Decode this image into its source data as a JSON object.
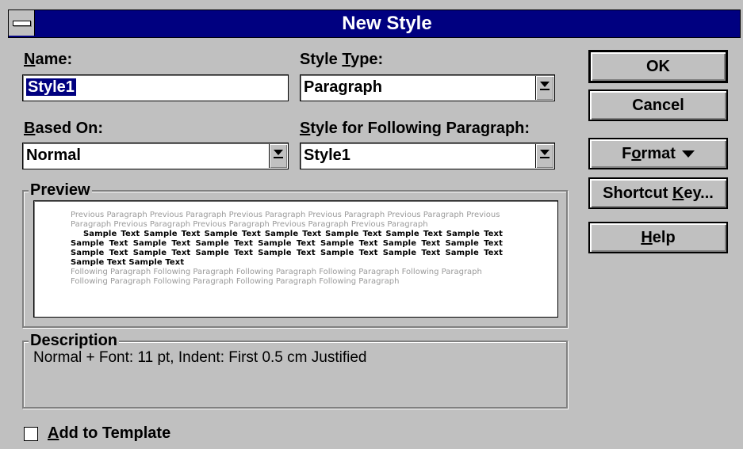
{
  "window": {
    "title": "New Style"
  },
  "fields": {
    "name_label_key": "N",
    "name_label_rest": "ame:",
    "name_value": "Style1",
    "style_type_label_pre": "Style ",
    "style_type_label_key": "T",
    "style_type_label_rest": "ype:",
    "style_type_value": "Paragraph",
    "based_on_label_key": "B",
    "based_on_label_rest": "ased On:",
    "based_on_value": "Normal",
    "following_label_key": "S",
    "following_label_rest": "tyle for Following Paragraph:",
    "following_value": "Style1"
  },
  "buttons": {
    "ok": "OK",
    "cancel": "Cancel",
    "format_pre": "F",
    "format_key": "o",
    "format_rest": "rmat",
    "shortcut_pre": "Shortcut ",
    "shortcut_key": "K",
    "shortcut_rest": "ey...",
    "help_key": "H",
    "help_rest": "elp"
  },
  "preview": {
    "label": "Preview",
    "previous_text": "Previous Paragraph Previous Paragraph Previous Paragraph Previous Paragraph Previous Paragraph Previous Paragraph Previous Paragraph Previous Paragraph Previous Paragraph Previous Paragraph",
    "sample_text": "Sample Text Sample Text Sample Text Sample Text Sample Text Sample Text Sample Text Sample Text Sample Text Sample Text Sample Text Sample Text Sample Text Sample Text Sample Text Sample Text Sample Text Sample Text Sample Text Sample Text Sample Text Sample Text Sample Text",
    "following_text": "Following Paragraph Following Paragraph Following Paragraph Following Paragraph Following Paragraph Following Paragraph Following Paragraph Following Paragraph Following Paragraph"
  },
  "description": {
    "label": "Description",
    "text": "Normal + Font: 11 pt, Indent:  First  0.5 cm Justified"
  },
  "add_to_template": {
    "label_key": "A",
    "label_rest": "dd to Template",
    "checked": false
  },
  "colors": {
    "title_bar": "#000080",
    "dialog_face": "#c0c0c0",
    "selection": "#000080"
  }
}
